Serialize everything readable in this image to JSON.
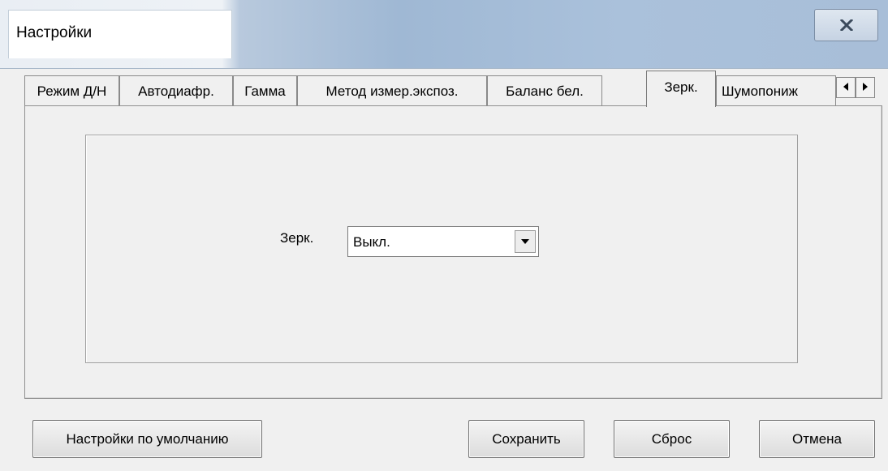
{
  "window": {
    "title": "Настройки",
    "close_icon": "close-icon"
  },
  "tabs": [
    {
      "label": "Режим Д/Н",
      "active": false
    },
    {
      "label": "Автодиафр.",
      "active": false
    },
    {
      "label": "Гамма",
      "active": false
    },
    {
      "label": "Метод измер.экспоз.",
      "active": false
    },
    {
      "label": "Баланс бел.",
      "active": false
    },
    {
      "label": "Зерк.",
      "active": true
    },
    {
      "label": "Шумопониж",
      "active": false
    }
  ],
  "tab_scroll": {
    "left_icon": "arrow-left-icon",
    "right_icon": "arrow-right-icon"
  },
  "mirror": {
    "label": "Зерк.",
    "value": "Выкл."
  },
  "buttons": {
    "defaults": "Настройки по умолчанию",
    "save": "Сохранить",
    "reset": "Сброс",
    "cancel": "Отмена"
  }
}
